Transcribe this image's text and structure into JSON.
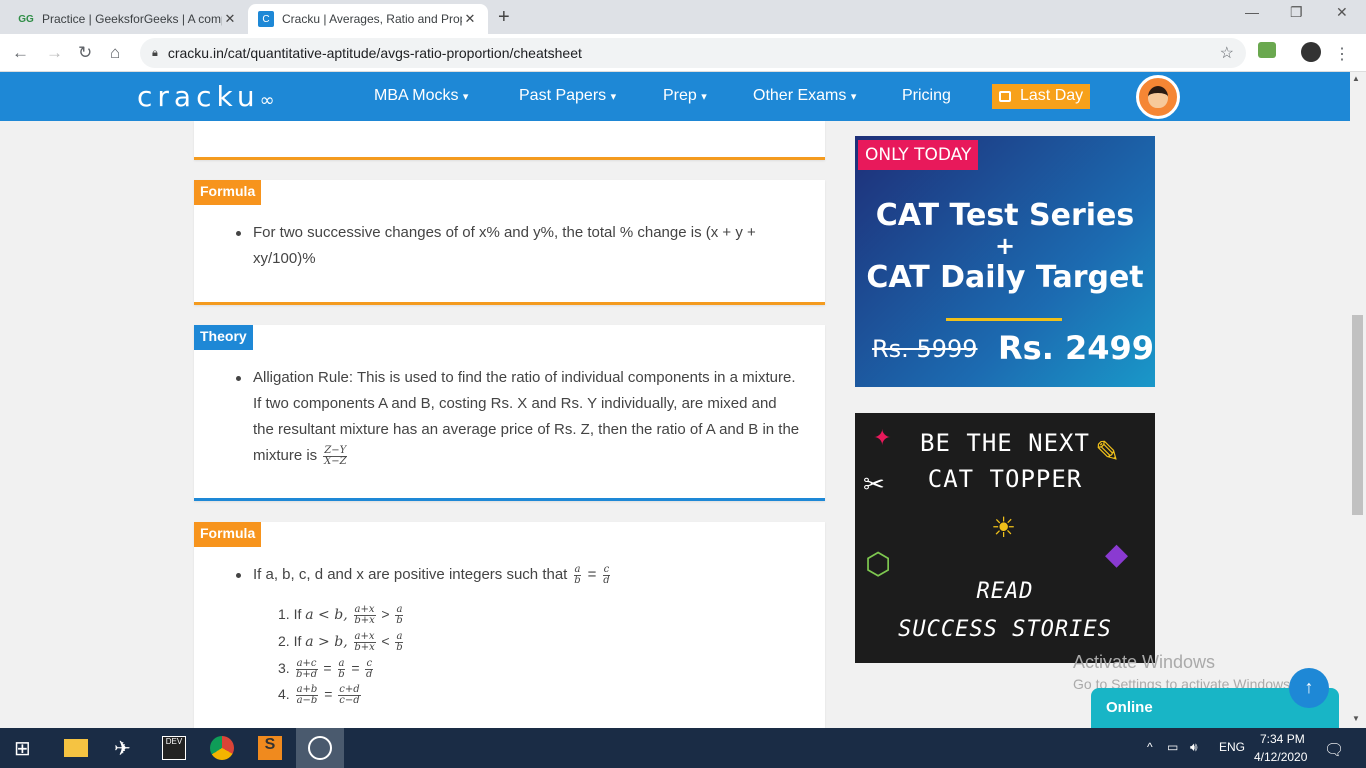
{
  "browser": {
    "tabs": [
      {
        "title": "Practice | GeeksforGeeks | A comp",
        "icon": "GG"
      },
      {
        "title": "Cracku | Averages, Ratio and Prop",
        "icon": "C"
      }
    ],
    "url": "cracku.in/cat/quantitative-aptitude/avgs-ratio-proportion/cheatsheet",
    "new_tab": "+",
    "close": "✕"
  },
  "header": {
    "logo": "cracku",
    "menu": [
      {
        "label": "MBA Mocks",
        "dropdown": true
      },
      {
        "label": "Past Papers",
        "dropdown": true
      },
      {
        "label": "Prep",
        "dropdown": true
      },
      {
        "label": "Other Exams",
        "dropdown": true
      },
      {
        "label": "Pricing",
        "dropdown": false
      }
    ],
    "cta": "Last Day",
    "chevron": "⌄"
  },
  "cards": {
    "formula1": {
      "tag": "Formula",
      "text": "For two successive changes of of x% and y%, the total % change is (x + y + xy/100)%"
    },
    "theory": {
      "tag": "Theory",
      "text": "Alligation Rule: This is used to find the ratio of individual components in a mixture. If two components A and B, costing Rs. X and Rs. Y individually, are mixed and the resultant mixture has an average price of Rs. Z, then the ratio of A and B in the mixture is",
      "frac_num": "Z−Y",
      "frac_den": "X−Z"
    },
    "formula2": {
      "tag": "Formula",
      "text": "If a, b, c, d and x are positive integers such that",
      "items": [
        {
          "n": "1.",
          "text": "If",
          "math": "a < b,",
          "f1n": "a+x",
          "f1d": "b+x",
          "op": ">",
          "f2n": "a",
          "f2d": "b"
        },
        {
          "n": "2.",
          "text": "If",
          "math": "a > b,",
          "f1n": "a+x",
          "f1d": "b+x",
          "op": "<",
          "f2n": "a",
          "f2d": "b"
        },
        {
          "n": "3.",
          "f1n": "a+c",
          "f1d": "b+d",
          "op": "=",
          "f2n": "a",
          "f2d": "b",
          "op2": "=",
          "f3n": "c",
          "f3d": "d"
        },
        {
          "n": "4.",
          "f1n": "a+b",
          "f1d": "a−b",
          "op": "=",
          "f2n": "c+d",
          "f2d": "c−d"
        }
      ]
    }
  },
  "ads": {
    "ad1": {
      "badge": "ONLY TODAY",
      "line1": "CAT Test Series",
      "plus": "+",
      "line2": "CAT Daily Target",
      "old_price": "Rs. 5999",
      "new_price": "Rs. 2499"
    },
    "ad2": {
      "line1": "BE THE NEXT",
      "line2": "CAT TOPPER",
      "line3": "READ",
      "line4": "SUCCESS STORIES"
    }
  },
  "overlay": {
    "watermark_title": "Activate Windows",
    "watermark_sub": "Go to Settings to activate Windows.",
    "chat": "Online",
    "scroll_up": "↑"
  },
  "taskbar": {
    "lang": "ENG",
    "time": "7:34 PM",
    "date": "4/12/2020"
  }
}
